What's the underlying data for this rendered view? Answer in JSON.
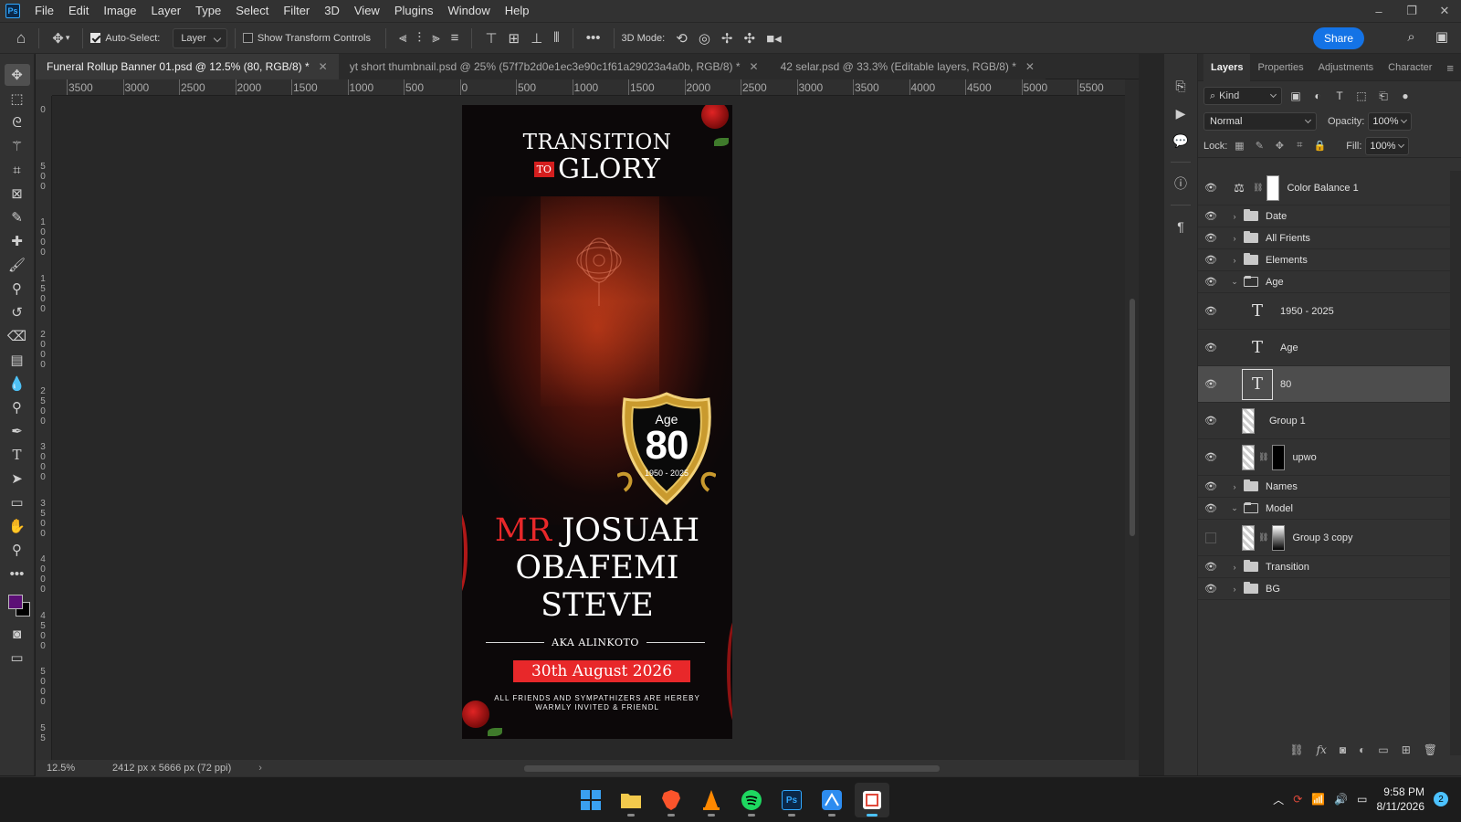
{
  "app": {
    "logo": "Ps"
  },
  "menu": [
    "File",
    "Edit",
    "Image",
    "Layer",
    "Type",
    "Select",
    "Filter",
    "3D",
    "View",
    "Plugins",
    "Window",
    "Help"
  ],
  "window_controls": {
    "minimize": "–",
    "restore": "❐",
    "close": "✕"
  },
  "options": {
    "auto_select_label": "Auto-Select:",
    "auto_select_checked": true,
    "auto_select_value": "Layer",
    "transform_controls_label": "Show Transform Controls",
    "transform_controls_checked": false,
    "three_d_mode_label": "3D Mode:",
    "share_label": "Share"
  },
  "tabs": [
    {
      "title": "Funeral Rollup Banner 01.psd @ 12.5% (80, RGB/8) *",
      "active": true
    },
    {
      "title": "yt short thumbnail.psd @ 25% (57f7b2d0e1ec3e90c1f61a29023a4a0b, RGB/8) *",
      "active": false
    },
    {
      "title": "42 selar.psd @ 33.3% (Editable layers, RGB/8) *",
      "active": false
    }
  ],
  "ruler_top_labels": [
    "3500",
    "3000",
    "2500",
    "2000",
    "1500",
    "1000",
    "500",
    "0",
    "500",
    "1000",
    "1500",
    "2000",
    "2500",
    "3000",
    "3500",
    "4000",
    "4500",
    "5000",
    "5500"
  ],
  "ruler_left_labels": [
    "0",
    "5 0 0",
    "1 0 0 0",
    "1 5 0 0",
    "2 0 0 0",
    "2 5 0 0",
    "3 0 0 0",
    "3 5 0 0",
    "4 0 0 0",
    "4 5 0 0",
    "5 0 0 0",
    "5 5"
  ],
  "artwork": {
    "title_line1": "TRANSITION",
    "title_to": "TO",
    "title_line2": "GLORY",
    "badge_age": "Age",
    "badge_number": "80",
    "badge_years": "1950 - 2025",
    "name_prefix": "MR",
    "name_line1": "JOSUAH",
    "name_line2": "OBAFEMI",
    "name_line3": "STEVE",
    "aka": "AKA ALINKOTO",
    "date": "30th August 2026",
    "invite_line1": "ALL FRIENDS AND SYMPATHIZERS ARE HEREBY",
    "invite_line2": "WARMLY  INVITED & FRIENDL",
    "accent_red": "#e8282a",
    "background": "#0c0809"
  },
  "status": {
    "zoom": "12.5%",
    "doc_info": "2412 px x 5666 px (72 ppi)"
  },
  "panel": {
    "tabs": [
      "Layers",
      "Properties",
      "Adjustments",
      "Character"
    ],
    "active_tab": "Layers",
    "filter_kind": "Kind",
    "blend_mode": "Normal",
    "opacity_label": "Opacity:",
    "opacity": "100%",
    "lock_label": "Lock:",
    "fill_label": "Fill:",
    "fill": "100%"
  },
  "layers": [
    {
      "name": "Color Balance 1",
      "kind": "adjustment",
      "visible": true
    },
    {
      "name": "Date",
      "kind": "group",
      "visible": true,
      "expanded": false
    },
    {
      "name": "All Frients",
      "kind": "group",
      "visible": true,
      "expanded": false
    },
    {
      "name": "Elements",
      "kind": "group",
      "visible": true,
      "expanded": false
    },
    {
      "name": "Age",
      "kind": "group",
      "visible": true,
      "expanded": true
    },
    {
      "name": "1950 - 2025",
      "kind": "text",
      "visible": true
    },
    {
      "name": "Age",
      "kind": "text",
      "visible": true
    },
    {
      "name": "80",
      "kind": "text",
      "visible": true,
      "selected": true
    },
    {
      "name": "Group 1",
      "kind": "image",
      "visible": true
    },
    {
      "name": "upwo",
      "kind": "image-mask",
      "visible": true
    },
    {
      "name": "Names",
      "kind": "group",
      "visible": true,
      "expanded": false
    },
    {
      "name": "Model",
      "kind": "group",
      "visible": true,
      "expanded": true
    },
    {
      "name": "Group 3 copy",
      "kind": "image-mask",
      "visible": false
    },
    {
      "name": "Transition",
      "kind": "group",
      "visible": true,
      "expanded": false
    },
    {
      "name": "BG",
      "kind": "group",
      "visible": true,
      "expanded": false
    }
  ],
  "taskbar": {
    "apps": [
      "windows-start",
      "file-explorer",
      "brave",
      "vlc",
      "spotify",
      "photoshop",
      "vectorize",
      "snipping-tool"
    ],
    "clock_time": "9:58 PM",
    "clock_date": "8/11/2026",
    "notification_count": "2"
  }
}
